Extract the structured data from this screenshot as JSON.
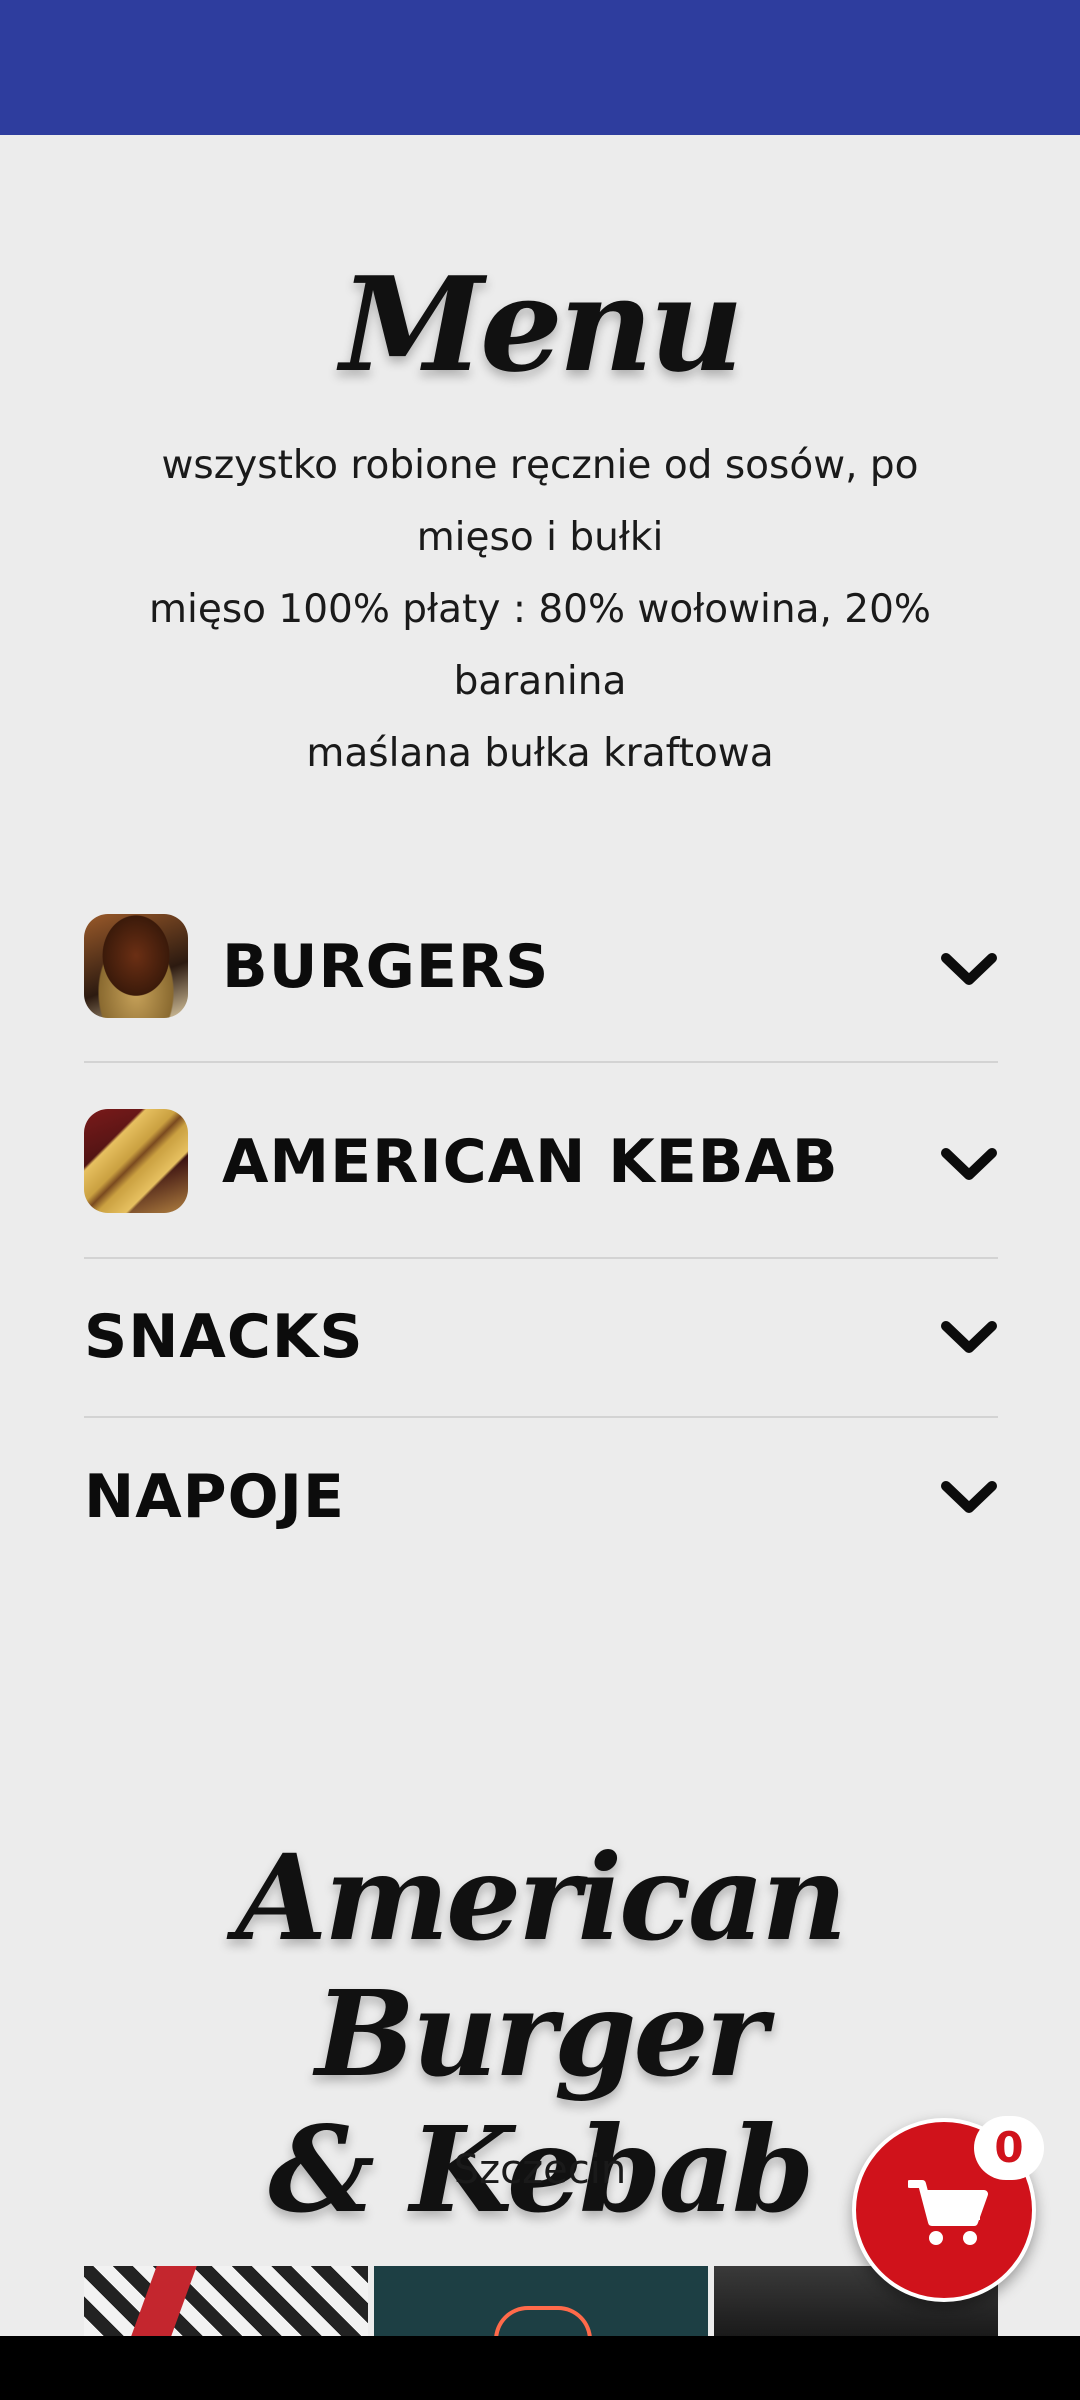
{
  "menu": {
    "title": "Menu",
    "description": [
      "wszystko robione ręcznie od sosów, po",
      "mięso i bułki",
      "mięso 100% płaty : 80% wołowina, 20%",
      "baranina",
      "maślana bułka kraftowa"
    ]
  },
  "categories": [
    {
      "label": "BURGERS",
      "icon": "burger-thumbnail"
    },
    {
      "label": "AMERICAN KEBAB",
      "icon": "kebab-thumbnail"
    },
    {
      "label": "SNACKS"
    },
    {
      "label": "NAPOJE"
    }
  ],
  "brand": {
    "title_line1": "American Burger",
    "title_line2": "& Kebab",
    "city": "Szczecin"
  },
  "cart": {
    "count": "0",
    "icon": "cart-icon"
  },
  "colors": {
    "header": "#2e3d9e",
    "accent": "#d0121b",
    "background": "#ececec"
  }
}
